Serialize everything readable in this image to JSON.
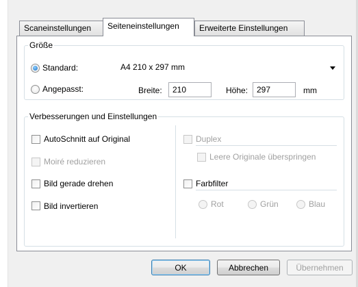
{
  "tabs": [
    {
      "label": "Scaneinstellungen"
    },
    {
      "label": "Seiteneinstellungen"
    },
    {
      "label": "Erweiterte Einstellungen"
    }
  ],
  "size_group": {
    "legend": "Größe",
    "standard_label": "Standard:",
    "standard_value": "A4 210 x 297 mm",
    "custom_label": "Angepasst:",
    "width_label": "Breite:",
    "width_value": "210",
    "height_label": "Höhe:",
    "height_value": "297",
    "unit": "mm"
  },
  "enhance_group": {
    "legend": "Verbesserungen und Einstellungen",
    "autocrop": "AutoSchnitt auf Original",
    "moire": "Moiré reduzieren",
    "deskew": "Bild gerade drehen",
    "invert": "Bild invertieren",
    "duplex": "Duplex",
    "skip_blank": "Leere Originale überspringen",
    "color_filter": "Farbfilter",
    "red": "Rot",
    "green": "Grün",
    "blue": "Blau"
  },
  "buttons": {
    "ok": "OK",
    "cancel": "Abbrechen",
    "apply": "Übernehmen"
  }
}
